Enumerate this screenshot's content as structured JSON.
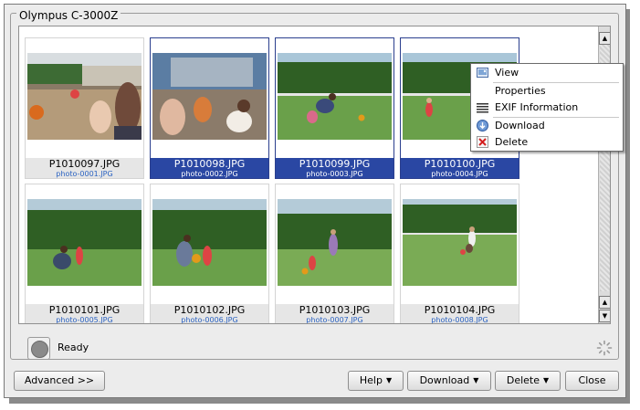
{
  "window": {
    "group_title": "Olympus C-3000Z"
  },
  "photos": [
    {
      "name": "P1010097.JPG",
      "file": "photo-0001.JPG",
      "selected": false
    },
    {
      "name": "P1010098.JPG",
      "file": "photo-0002.JPG",
      "selected": true
    },
    {
      "name": "P1010099.JPG",
      "file": "photo-0003.JPG",
      "selected": true
    },
    {
      "name": "P1010100.JPG",
      "file": "photo-0004.JPG",
      "selected": true
    },
    {
      "name": "P1010101.JPG",
      "file": "photo-0005.JPG",
      "selected": false
    },
    {
      "name": "P1010102.JPG",
      "file": "photo-0006.JPG",
      "selected": false
    },
    {
      "name": "P1010103.JPG",
      "file": "photo-0007.JPG",
      "selected": false
    },
    {
      "name": "P1010104.JPG",
      "file": "photo-0008.JPG",
      "selected": false
    }
  ],
  "context_menu": {
    "items": [
      {
        "label": "View",
        "icon": "view-icon"
      },
      {
        "label": "Properties",
        "icon": ""
      },
      {
        "label": "EXIF Information",
        "icon": "exif-list-icon"
      },
      {
        "label": "Download",
        "icon": "download-icon"
      },
      {
        "label": "Delete",
        "icon": "delete-icon"
      }
    ]
  },
  "status": {
    "text": "Ready"
  },
  "buttons": {
    "advanced": "Advanced >>",
    "help": "Help",
    "download": "Download",
    "delete": "Delete",
    "close": "Close"
  },
  "colors": {
    "selection": "#2a47a3",
    "link_text": "#2b63c2"
  }
}
